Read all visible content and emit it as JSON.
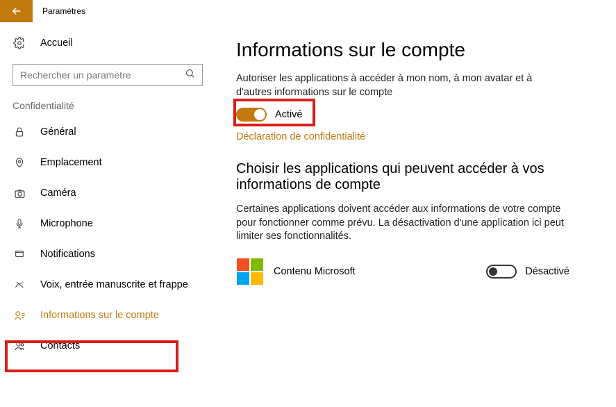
{
  "titlebar": {
    "title": "Paramètres"
  },
  "sidebar": {
    "home": "Accueil",
    "search_placeholder": "Rechercher un paramètre",
    "category": "Confidentialité",
    "items": [
      {
        "label": "Général"
      },
      {
        "label": "Emplacement"
      },
      {
        "label": "Caméra"
      },
      {
        "label": "Microphone"
      },
      {
        "label": "Notifications"
      },
      {
        "label": "Voix, entrée manuscrite et frappe"
      },
      {
        "label": "Informations sur le compte"
      },
      {
        "label": "Contacts"
      }
    ]
  },
  "main": {
    "heading": "Informations sur le compte",
    "description": "Autoriser les applications à accéder à mon nom, à mon avatar et à d'autres informations sur le compte",
    "toggle_state": "Activé",
    "privacy_link": "Déclaration de confidentialité",
    "subheading": "Choisir les applications qui peuvent accéder à vos informations de compte",
    "subdesc": "Certaines applications doivent accéder aux informations de votre compte pour fonctionner comme prévu. La désactivation d'une application ici peut limiter ses fonctionnalités.",
    "apps": [
      {
        "name": "Contenu Microsoft",
        "state": "Désactivé"
      }
    ]
  },
  "colors": {
    "accent": "#c17a0b",
    "highlight": "#d91e18"
  }
}
